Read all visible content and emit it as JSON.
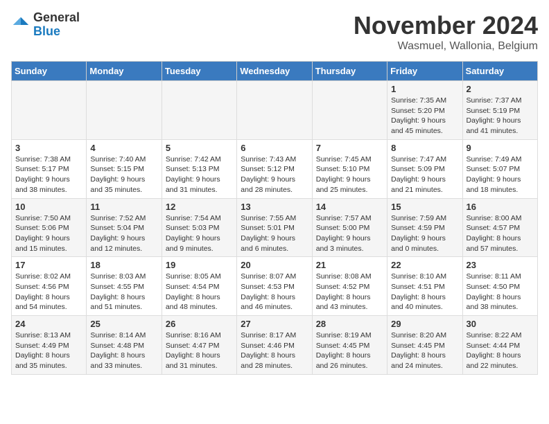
{
  "logo": {
    "general": "General",
    "blue": "Blue"
  },
  "header": {
    "month": "November 2024",
    "location": "Wasmuel, Wallonia, Belgium"
  },
  "weekdays": [
    "Sunday",
    "Monday",
    "Tuesday",
    "Wednesday",
    "Thursday",
    "Friday",
    "Saturday"
  ],
  "weeks": [
    [
      {
        "day": "",
        "info": ""
      },
      {
        "day": "",
        "info": ""
      },
      {
        "day": "",
        "info": ""
      },
      {
        "day": "",
        "info": ""
      },
      {
        "day": "",
        "info": ""
      },
      {
        "day": "1",
        "info": "Sunrise: 7:35 AM\nSunset: 5:20 PM\nDaylight: 9 hours and 45 minutes."
      },
      {
        "day": "2",
        "info": "Sunrise: 7:37 AM\nSunset: 5:19 PM\nDaylight: 9 hours and 41 minutes."
      }
    ],
    [
      {
        "day": "3",
        "info": "Sunrise: 7:38 AM\nSunset: 5:17 PM\nDaylight: 9 hours and 38 minutes."
      },
      {
        "day": "4",
        "info": "Sunrise: 7:40 AM\nSunset: 5:15 PM\nDaylight: 9 hours and 35 minutes."
      },
      {
        "day": "5",
        "info": "Sunrise: 7:42 AM\nSunset: 5:13 PM\nDaylight: 9 hours and 31 minutes."
      },
      {
        "day": "6",
        "info": "Sunrise: 7:43 AM\nSunset: 5:12 PM\nDaylight: 9 hours and 28 minutes."
      },
      {
        "day": "7",
        "info": "Sunrise: 7:45 AM\nSunset: 5:10 PM\nDaylight: 9 hours and 25 minutes."
      },
      {
        "day": "8",
        "info": "Sunrise: 7:47 AM\nSunset: 5:09 PM\nDaylight: 9 hours and 21 minutes."
      },
      {
        "day": "9",
        "info": "Sunrise: 7:49 AM\nSunset: 5:07 PM\nDaylight: 9 hours and 18 minutes."
      }
    ],
    [
      {
        "day": "10",
        "info": "Sunrise: 7:50 AM\nSunset: 5:06 PM\nDaylight: 9 hours and 15 minutes."
      },
      {
        "day": "11",
        "info": "Sunrise: 7:52 AM\nSunset: 5:04 PM\nDaylight: 9 hours and 12 minutes."
      },
      {
        "day": "12",
        "info": "Sunrise: 7:54 AM\nSunset: 5:03 PM\nDaylight: 9 hours and 9 minutes."
      },
      {
        "day": "13",
        "info": "Sunrise: 7:55 AM\nSunset: 5:01 PM\nDaylight: 9 hours and 6 minutes."
      },
      {
        "day": "14",
        "info": "Sunrise: 7:57 AM\nSunset: 5:00 PM\nDaylight: 9 hours and 3 minutes."
      },
      {
        "day": "15",
        "info": "Sunrise: 7:59 AM\nSunset: 4:59 PM\nDaylight: 9 hours and 0 minutes."
      },
      {
        "day": "16",
        "info": "Sunrise: 8:00 AM\nSunset: 4:57 PM\nDaylight: 8 hours and 57 minutes."
      }
    ],
    [
      {
        "day": "17",
        "info": "Sunrise: 8:02 AM\nSunset: 4:56 PM\nDaylight: 8 hours and 54 minutes."
      },
      {
        "day": "18",
        "info": "Sunrise: 8:03 AM\nSunset: 4:55 PM\nDaylight: 8 hours and 51 minutes."
      },
      {
        "day": "19",
        "info": "Sunrise: 8:05 AM\nSunset: 4:54 PM\nDaylight: 8 hours and 48 minutes."
      },
      {
        "day": "20",
        "info": "Sunrise: 8:07 AM\nSunset: 4:53 PM\nDaylight: 8 hours and 46 minutes."
      },
      {
        "day": "21",
        "info": "Sunrise: 8:08 AM\nSunset: 4:52 PM\nDaylight: 8 hours and 43 minutes."
      },
      {
        "day": "22",
        "info": "Sunrise: 8:10 AM\nSunset: 4:51 PM\nDaylight: 8 hours and 40 minutes."
      },
      {
        "day": "23",
        "info": "Sunrise: 8:11 AM\nSunset: 4:50 PM\nDaylight: 8 hours and 38 minutes."
      }
    ],
    [
      {
        "day": "24",
        "info": "Sunrise: 8:13 AM\nSunset: 4:49 PM\nDaylight: 8 hours and 35 minutes."
      },
      {
        "day": "25",
        "info": "Sunrise: 8:14 AM\nSunset: 4:48 PM\nDaylight: 8 hours and 33 minutes."
      },
      {
        "day": "26",
        "info": "Sunrise: 8:16 AM\nSunset: 4:47 PM\nDaylight: 8 hours and 31 minutes."
      },
      {
        "day": "27",
        "info": "Sunrise: 8:17 AM\nSunset: 4:46 PM\nDaylight: 8 hours and 28 minutes."
      },
      {
        "day": "28",
        "info": "Sunrise: 8:19 AM\nSunset: 4:45 PM\nDaylight: 8 hours and 26 minutes."
      },
      {
        "day": "29",
        "info": "Sunrise: 8:20 AM\nSunset: 4:45 PM\nDaylight: 8 hours and 24 minutes."
      },
      {
        "day": "30",
        "info": "Sunrise: 8:22 AM\nSunset: 4:44 PM\nDaylight: 8 hours and 22 minutes."
      }
    ]
  ]
}
